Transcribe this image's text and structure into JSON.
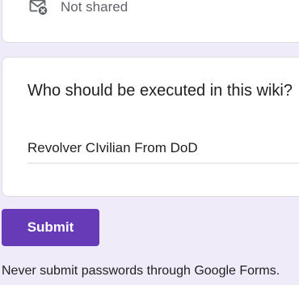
{
  "share_status": {
    "icon": "mail-not-shared-icon",
    "text": "Not shared"
  },
  "question": {
    "title": "Who should be executed in this wiki?",
    "answer": "Revolver CIvilian From DoD"
  },
  "submit": {
    "label": "Submit"
  },
  "footer": {
    "note": "Never submit passwords through Google Forms."
  },
  "colors": {
    "background": "#f0ebf8",
    "accent": "#673ab7"
  }
}
